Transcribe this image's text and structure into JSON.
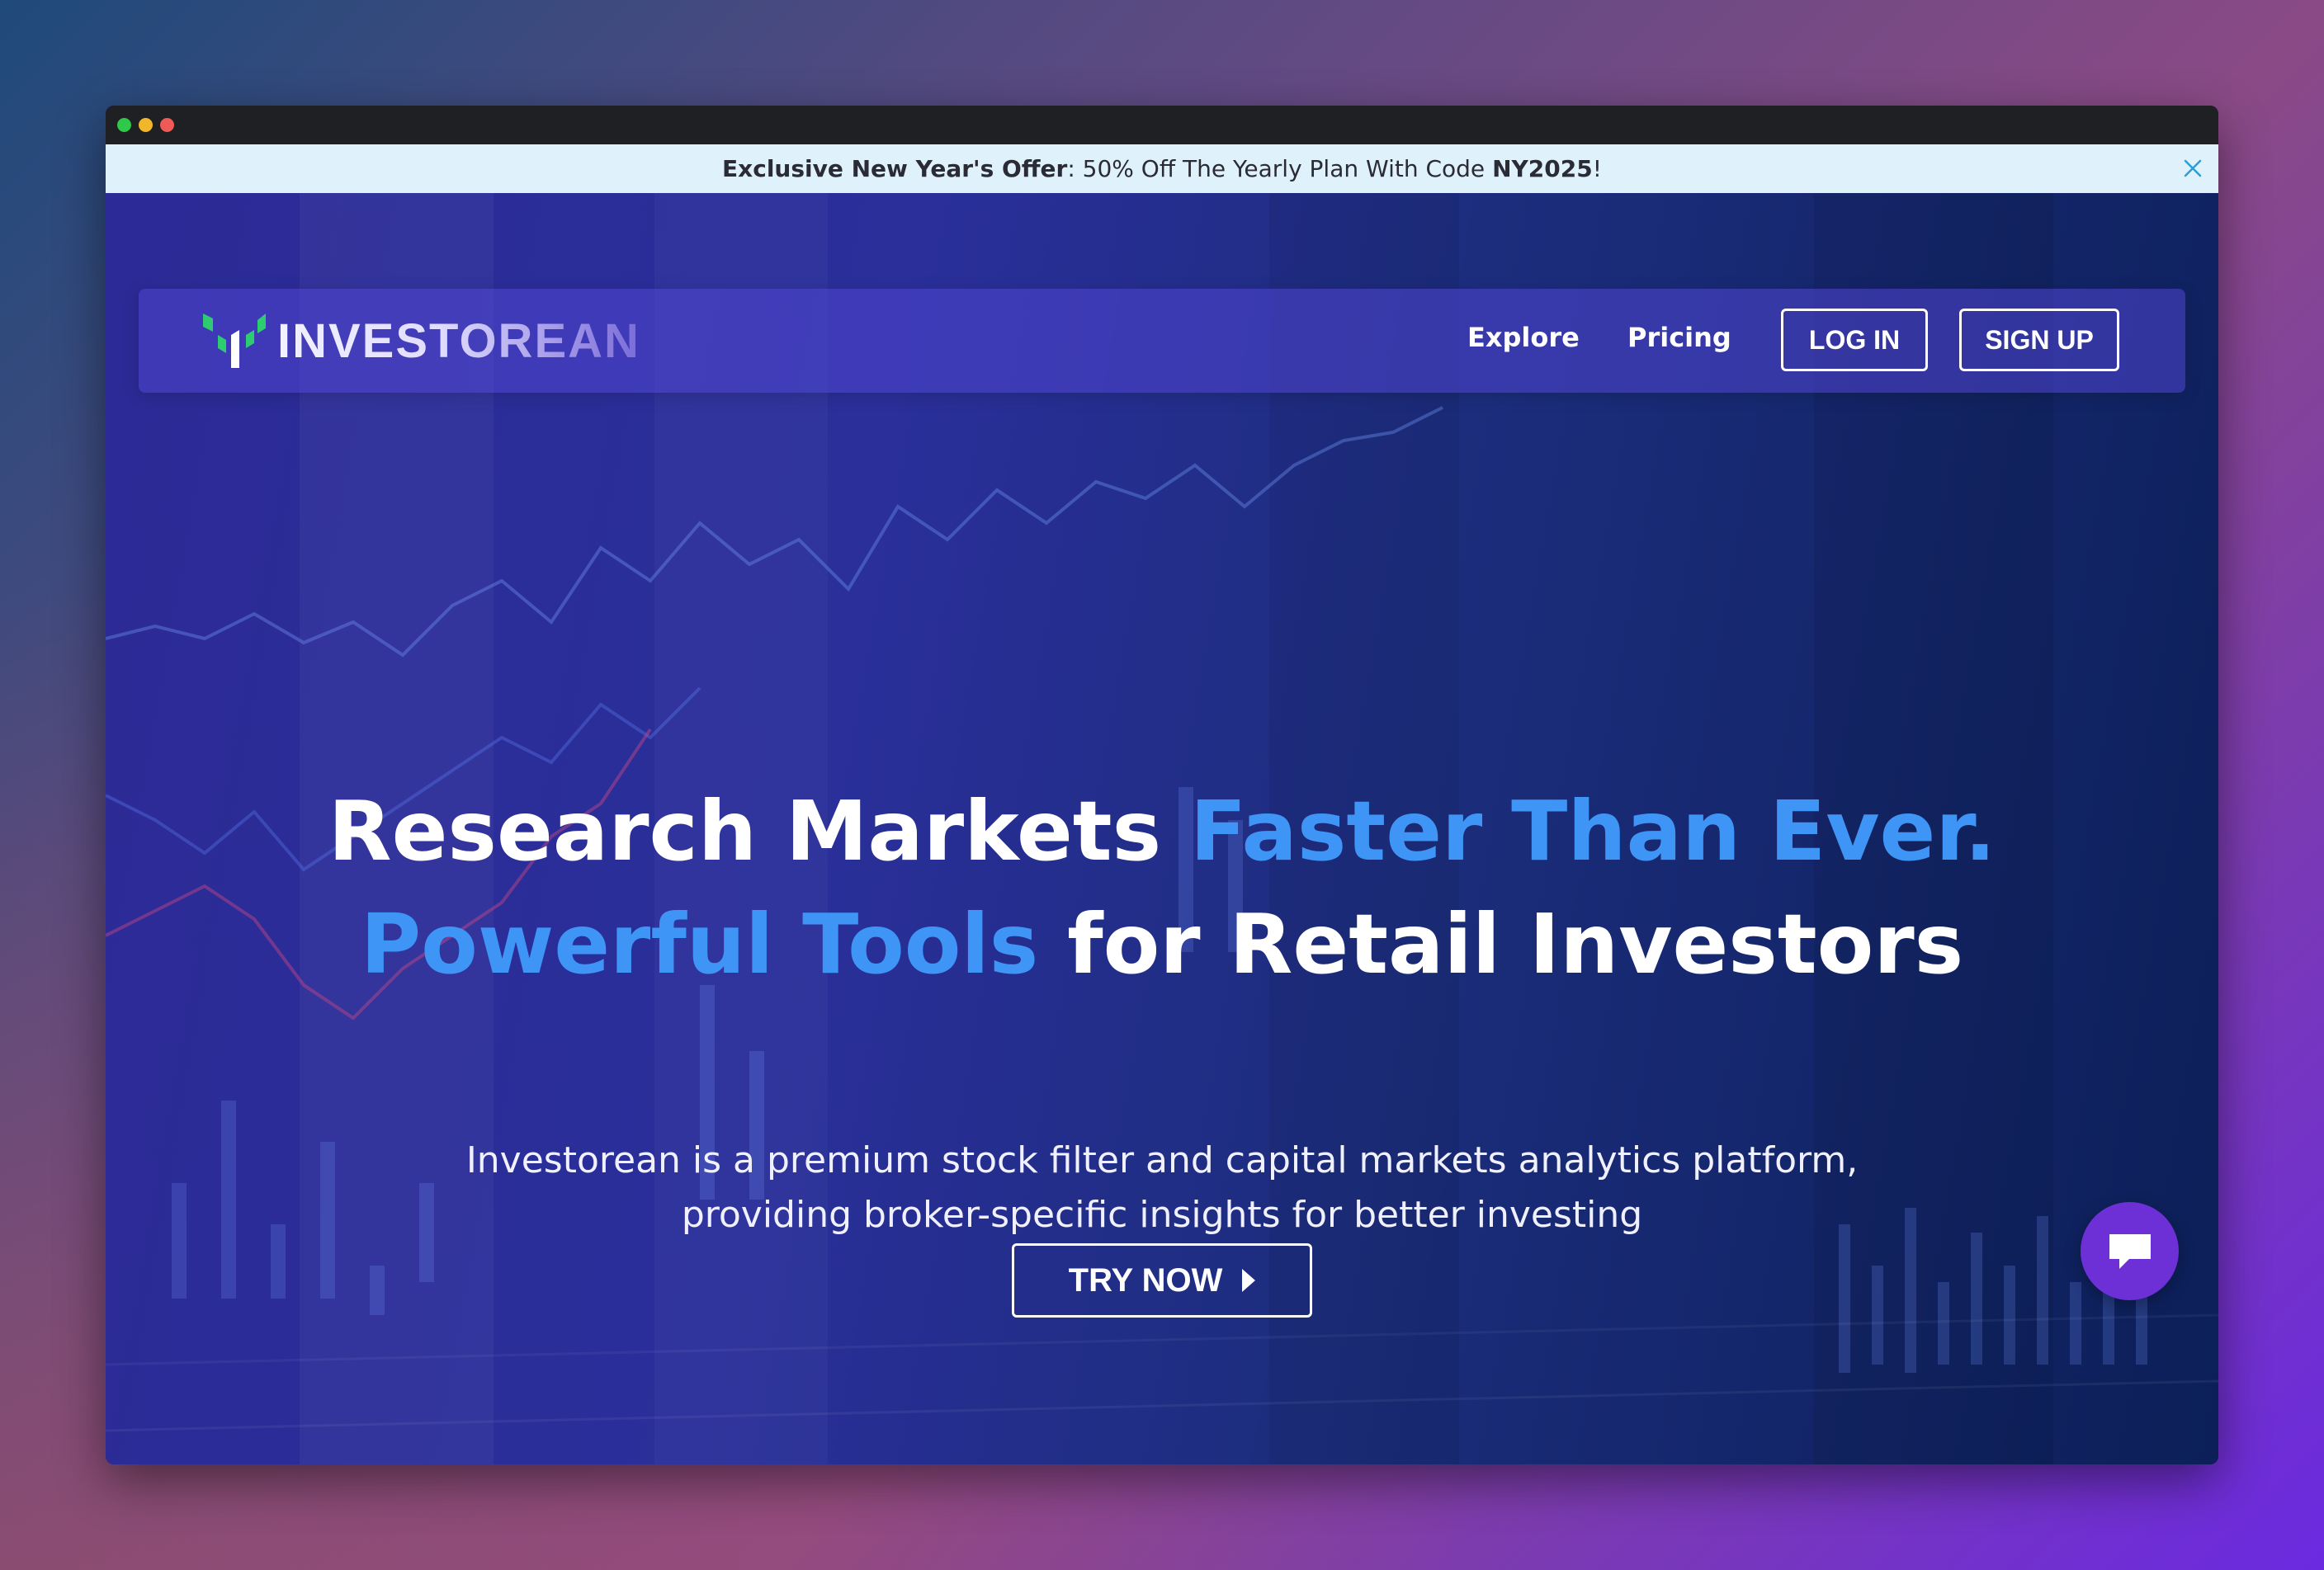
{
  "promo": {
    "bold_lead": "Exclusive New Year's Offer",
    "text": ": 50% Off The Yearly Plan With Code ",
    "code": "NY2025",
    "tail": "!",
    "close_icon": "close-icon"
  },
  "brand": {
    "name": "INVESTOREAN",
    "logo_icon": "investorean-logo-icon",
    "logo_colors": [
      "#2ecc71",
      "#ffffff"
    ]
  },
  "nav": {
    "explore": "Explore",
    "pricing": "Pricing",
    "login": "LOG IN",
    "signup": "SIGN UP"
  },
  "hero": {
    "line1_white": "Research Markets ",
    "line1_accent": "Faster Than Ever.",
    "line2_accent": "Powerful Tools",
    "line2_white": " for Retail Investors",
    "sub_line1": "Investorean is a premium stock filter and capital markets analytics platform,",
    "sub_line2": "providing broker-specific insights for better investing",
    "cta": "TRY NOW",
    "cta_icon": "caret-right-icon",
    "accent_color": "#3f95f6"
  },
  "chat": {
    "icon": "chat-bubble-icon",
    "color": "#6d2fd6"
  }
}
